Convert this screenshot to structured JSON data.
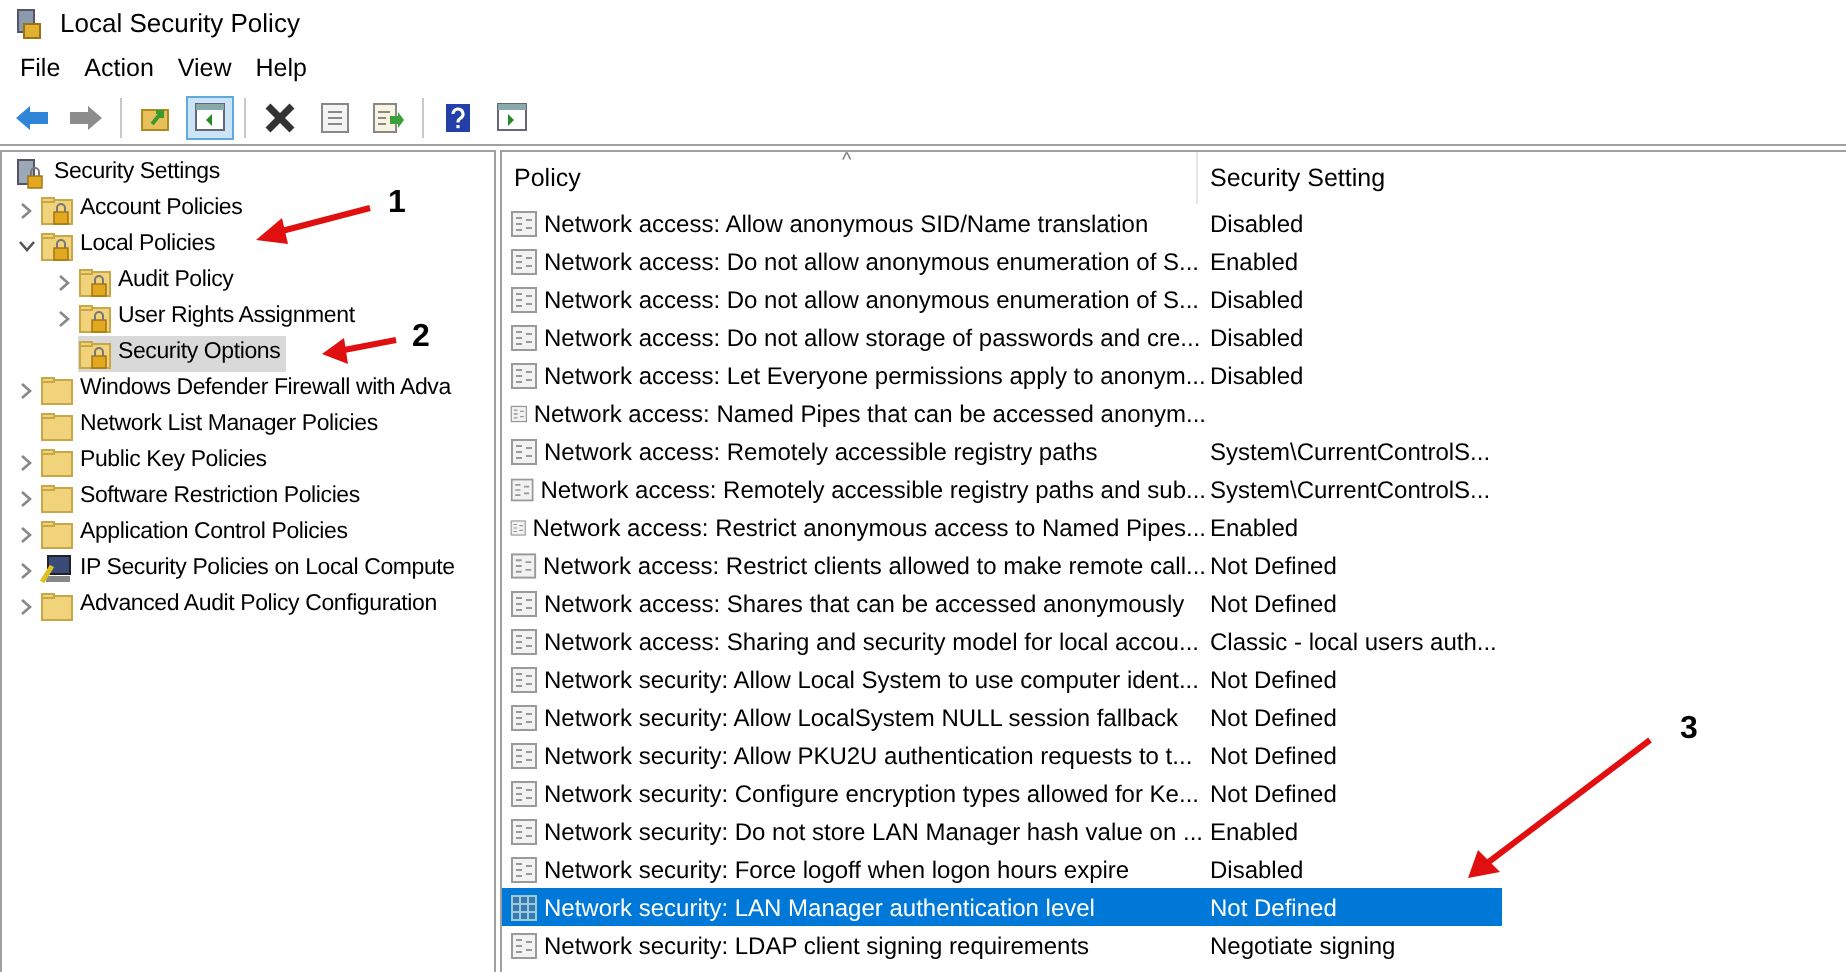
{
  "window": {
    "title": "Local Security Policy"
  },
  "menu": [
    "File",
    "Action",
    "View",
    "Help"
  ],
  "toolbar": [
    [
      {
        "kind": "back",
        "pressed": false
      },
      {
        "kind": "forward",
        "pressed": false
      }
    ],
    [
      {
        "kind": "up",
        "pressed": false
      },
      {
        "kind": "tree",
        "pressed": true
      }
    ],
    [
      {
        "kind": "delete",
        "pressed": false
      },
      {
        "kind": "properties",
        "pressed": false
      },
      {
        "kind": "export",
        "pressed": false
      }
    ],
    [
      {
        "kind": "help",
        "pressed": false
      },
      {
        "kind": "pane",
        "pressed": false
      }
    ]
  ],
  "tree": [
    {
      "label": "Security Settings",
      "kind": "root",
      "selected": false,
      "children": [
        {
          "label": "Account Policies",
          "kind": "folder-lock",
          "expanded": false,
          "selected": false
        },
        {
          "label": "Local Policies",
          "kind": "folder-lock",
          "expanded": true,
          "selected": false,
          "children": [
            {
              "label": "Audit Policy",
              "kind": "folder-lock",
              "expanded": false,
              "selected": false
            },
            {
              "label": "User Rights Assignment",
              "kind": "folder-lock",
              "expanded": false,
              "selected": false
            },
            {
              "label": "Security Options",
              "kind": "folder-lock",
              "selected": true
            }
          ]
        },
        {
          "label": "Windows Defender Firewall with Adva",
          "kind": "folder",
          "expanded": false,
          "selected": false
        },
        {
          "label": "Network List Manager Policies",
          "kind": "folder",
          "selected": false
        },
        {
          "label": "Public Key Policies",
          "kind": "folder",
          "expanded": false,
          "selected": false
        },
        {
          "label": "Software Restriction Policies",
          "kind": "folder",
          "expanded": false,
          "selected": false
        },
        {
          "label": "Application Control Policies",
          "kind": "folder",
          "expanded": false,
          "selected": false
        },
        {
          "label": "IP Security Policies on Local Compute",
          "kind": "ip-security",
          "expanded": false,
          "selected": false
        },
        {
          "label": "Advanced Audit Policy Configuration",
          "kind": "folder",
          "expanded": false,
          "selected": false
        }
      ]
    }
  ],
  "table": {
    "columns": [
      "Policy",
      "Security Setting"
    ],
    "sort_indicator": "^",
    "rows": [
      {
        "policy": "Network access: Allow anonymous SID/Name translation",
        "setting": "Disabled",
        "selected": false
      },
      {
        "policy": "Network access: Do not allow anonymous enumeration of S...",
        "setting": "Enabled",
        "selected": false
      },
      {
        "policy": "Network access: Do not allow anonymous enumeration of S...",
        "setting": "Disabled",
        "selected": false
      },
      {
        "policy": "Network access: Do not allow storage of passwords and cre...",
        "setting": "Disabled",
        "selected": false
      },
      {
        "policy": "Network access: Let Everyone permissions apply to anonym...",
        "setting": "Disabled",
        "selected": false
      },
      {
        "policy": "Network access: Named Pipes that can be accessed anonym...",
        "selected": false
      },
      {
        "policy": "Network access: Remotely accessible registry paths",
        "setting": "System\\CurrentControlS...",
        "selected": false
      },
      {
        "policy": "Network access: Remotely accessible registry paths and sub...",
        "setting": "System\\CurrentControlS...",
        "selected": false
      },
      {
        "policy": "Network access: Restrict anonymous access to Named Pipes...",
        "setting": "Enabled",
        "selected": false
      },
      {
        "policy": "Network access: Restrict clients allowed to make remote call...",
        "setting": "Not Defined",
        "selected": false
      },
      {
        "policy": "Network access: Shares that can be accessed anonymously",
        "setting": "Not Defined",
        "selected": false
      },
      {
        "policy": "Network access: Sharing and security model for local accou...",
        "setting": "Classic - local users auth...",
        "selected": false
      },
      {
        "policy": "Network security: Allow Local System to use computer ident...",
        "setting": "Not Defined",
        "selected": false
      },
      {
        "policy": "Network security: Allow LocalSystem NULL session fallback",
        "setting": "Not Defined",
        "selected": false
      },
      {
        "policy": "Network security: Allow PKU2U authentication requests to t...",
        "setting": "Not Defined",
        "selected": false
      },
      {
        "policy": "Network security: Configure encryption types allowed for Ke...",
        "setting": "Not Defined",
        "selected": false
      },
      {
        "policy": "Network security: Do not store LAN Manager hash value on ...",
        "setting": "Enabled",
        "selected": false
      },
      {
        "policy": "Network security: Force logoff when logon hours expire",
        "setting": "Disabled",
        "selected": false
      },
      {
        "policy": "Network security: LAN Manager authentication level",
        "setting": "Not Defined",
        "selected": true
      },
      {
        "policy": "Network security: LDAP client signing requirements",
        "setting": "Negotiate signing",
        "selected": false
      }
    ]
  },
  "annotations": [
    "1",
    "2",
    "3"
  ]
}
